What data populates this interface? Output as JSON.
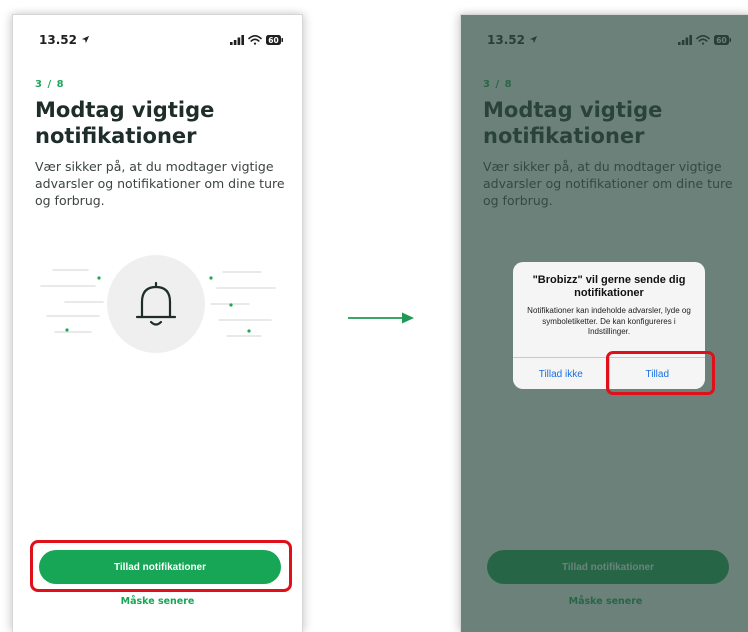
{
  "colors": {
    "accent": "#17a556",
    "step_green": "#22a55a",
    "highlight_red": "#e0101a",
    "dim_overlay": "#2d4c42",
    "ios_blue": "#1a6fe0",
    "arrow": "#1e9a54"
  },
  "status_bar": {
    "time": "13.52",
    "battery": "60"
  },
  "onboarding": {
    "step": "3 / 8",
    "title": "Modtag vigtige notifikationer",
    "description": "Vær sikker på, at du modtager vigtige advarsler og notifikationer om dine ture og forbrug.",
    "illustration_icon": "bell-icon",
    "primary_button": "Tillad notifikationer",
    "secondary_link": "Måske senere"
  },
  "permission_dialog": {
    "title": "\"Brobizz\" vil gerne sende dig notifikationer",
    "message": "Notifikationer kan indeholde advarsler, lyde og symboletiketter. De kan konfigureres i Indstillinger.",
    "deny_button": "Tillad ikke",
    "allow_button": "Tillad"
  }
}
